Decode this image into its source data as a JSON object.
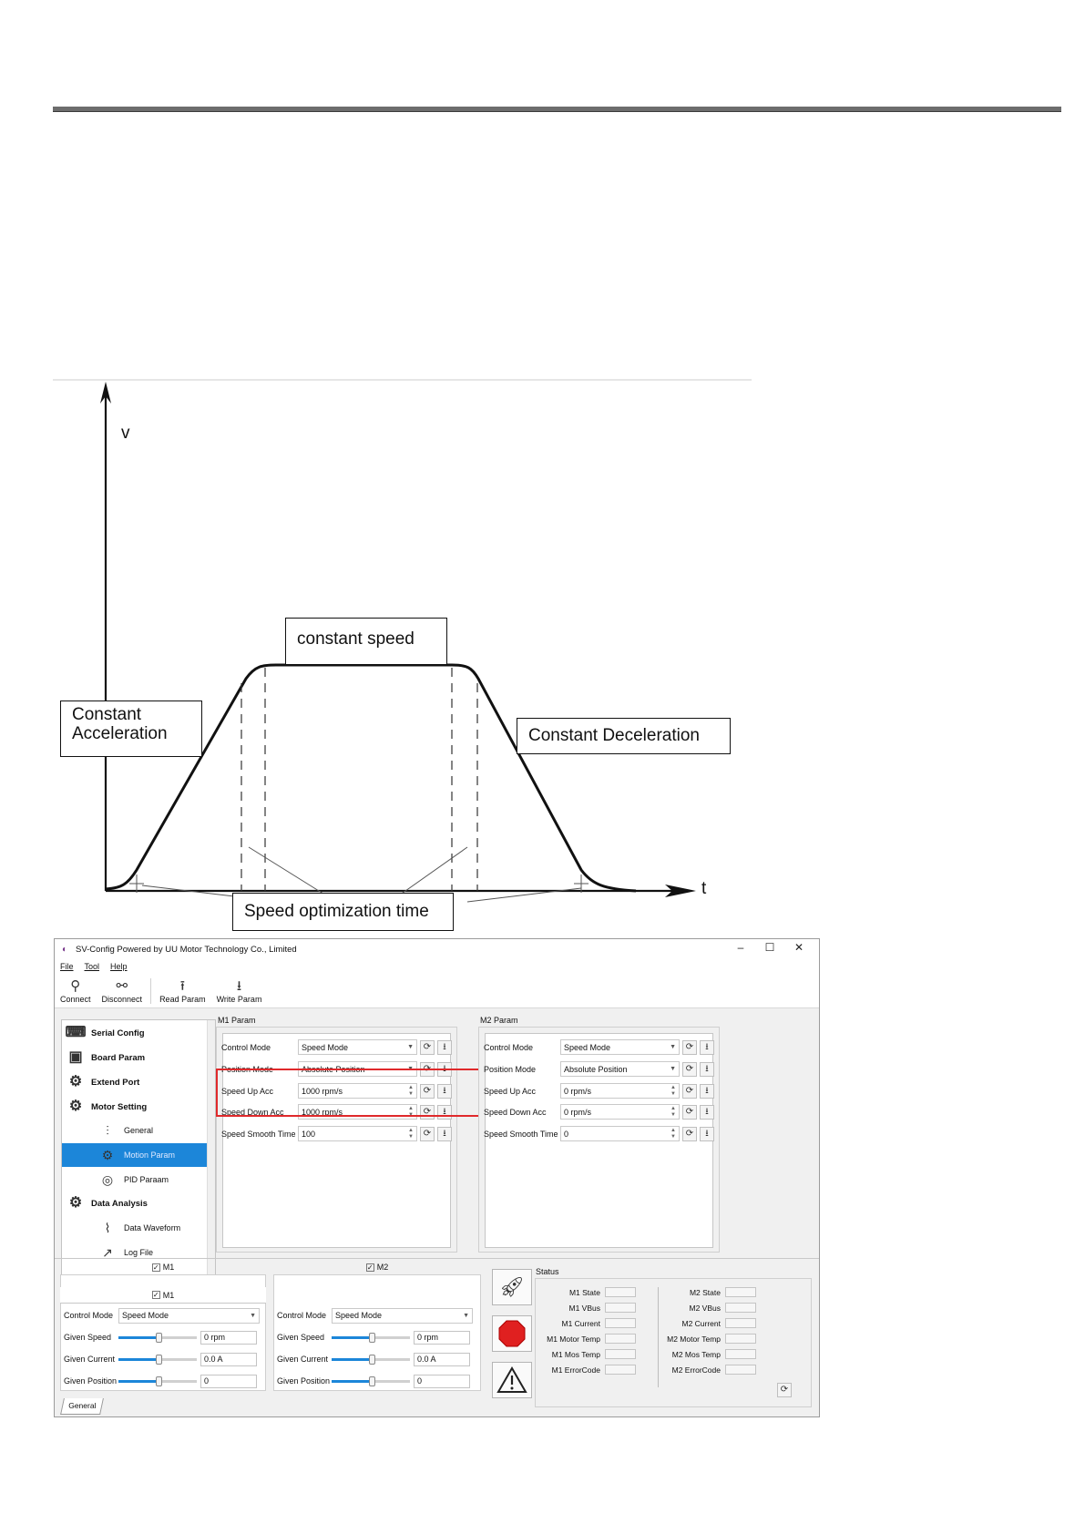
{
  "figure": {
    "v_axis_label": "v",
    "t_axis_label": "t",
    "label_constant_speed": "constant speed",
    "label_acc_line1": "Constant",
    "label_acc_line2": "Acceleration",
    "label_dec": "Constant Deceleration",
    "label_opt": "Speed optimization time"
  },
  "app": {
    "title": "SV-Config Powered by UU Motor Technology Co., Limited",
    "window_buttons": {
      "minimize": "–",
      "maximize": "☐",
      "close": "✕"
    },
    "menu": [
      "File",
      "Tool",
      "Help"
    ],
    "toolbar": [
      {
        "label": "Connect",
        "icon": "plug-icon"
      },
      {
        "label": "Disconnect",
        "icon": "unplug-icon"
      },
      {
        "label": "Read Param",
        "icon": "upload-arrow-icon"
      },
      {
        "label": "Write Param",
        "icon": "download-arrow-icon"
      }
    ],
    "nav": {
      "serial_config": "Serial Config",
      "board_param": "Board Param",
      "extend_port": "Extend Port",
      "motor_setting": "Motor Setting",
      "general": "General",
      "motion_param": "Motion Param",
      "pid_param": "PID Paraam",
      "data_analysis": "Data Analysis",
      "data_waveform": "Data Waveform",
      "log_file": "Log File"
    },
    "m1_param": {
      "title": "M1 Param",
      "control_mode_label": "Control Mode",
      "control_mode": "Speed Mode",
      "position_mode_label": "Position Mode",
      "position_mode": "Absolute Position",
      "speed_up_label": "Speed Up Acc",
      "speed_up": "1000 rpm/s",
      "speed_down_label": "Speed Down Acc",
      "speed_down": "1000 rpm/s",
      "smooth_label": "Speed Smooth Time",
      "smooth": "100"
    },
    "m2_param": {
      "title": "M2 Param",
      "control_mode_label": "Control Mode",
      "control_mode": "Speed Mode",
      "position_mode_label": "Position Mode",
      "position_mode": "Absolute Position",
      "speed_up_label": "Speed Up Acc",
      "speed_up": "0 rpm/s",
      "speed_down_label": "Speed Down Acc",
      "speed_down": "0 rpm/s",
      "smooth_label": "Speed Smooth Time",
      "smooth": "0"
    },
    "m1_panel": {
      "tab": "M1",
      "control_mode_label": "Control Mode",
      "control_mode": "Speed Mode",
      "given_speed_label": "Given Speed",
      "given_speed": "0 rpm",
      "given_current_label": "Given Current",
      "given_current": "0.0 A",
      "given_position_label": "Given Position",
      "given_position": "0"
    },
    "m2_panel": {
      "tab": "M2",
      "control_mode_label": "Control Mode",
      "control_mode": "Speed Mode",
      "given_speed_label": "Given Speed",
      "given_speed": "0 rpm",
      "given_current_label": "Given Current",
      "given_current": "0.0 A",
      "given_position_label": "Given Position",
      "given_position": "0"
    },
    "status": {
      "title": "Status",
      "m1": [
        "M1 State",
        "M1 VBus",
        "M1 Current",
        "M1 Motor Temp",
        "M1 Mos Temp",
        "M1 ErrorCode"
      ],
      "m2": [
        "M2 State",
        "M2 VBus",
        "M2 Current",
        "M2 Motor Temp",
        "M2 Mos Temp",
        "M2 ErrorCode"
      ]
    },
    "bottom_tab": "General",
    "colors": {
      "selected": "#1c86d9",
      "highlight": "#e0292b",
      "stop": "#e02020"
    }
  }
}
